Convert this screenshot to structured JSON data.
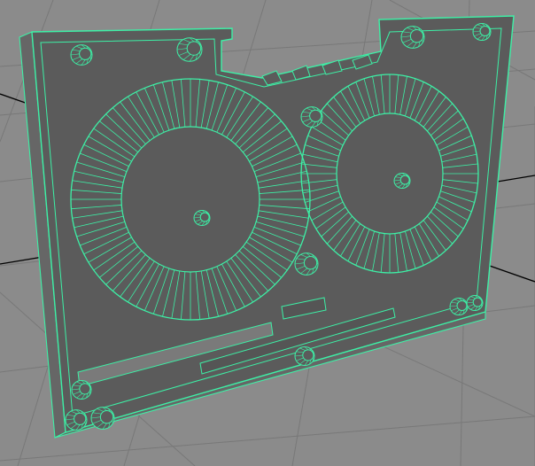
{
  "viewport": {
    "background": "#8b8b8b",
    "grid_color": "#7a7a7a",
    "axis_color": "#000000",
    "wire_color": "#3df0a6",
    "fill_color": "#5b5b5b"
  },
  "model": {
    "type": "wireframe-mesh",
    "subject": "cassette-tape-shell",
    "selected": true
  }
}
